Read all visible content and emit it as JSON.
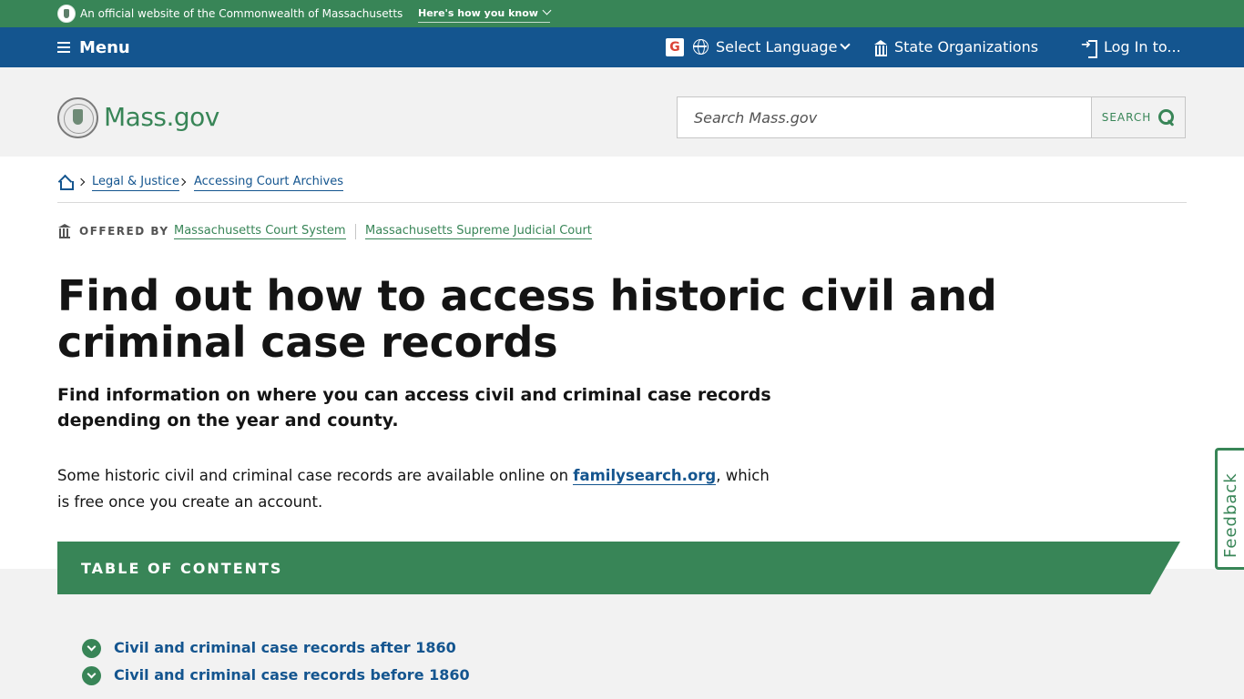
{
  "official_bar": {
    "text": "An official website of the Commonwealth of Massachusetts",
    "how_link": "Here's how you know"
  },
  "utility_nav": {
    "menu_label": "Menu",
    "google_letter": "G",
    "language_label": "Select Language",
    "orgs_label": "State Organizations",
    "login_label": "Log In to..."
  },
  "header": {
    "logo_text": "Mass.gov",
    "search_placeholder": "Search Mass.gov",
    "search_button": "SEARCH"
  },
  "breadcrumbs": [
    "Legal & Justice",
    "Accessing Court Archives"
  ],
  "offered_by": {
    "label": "OFFERED BY",
    "orgs": [
      "Massachusetts Court System",
      "Massachusetts Supreme Judicial Court"
    ]
  },
  "page": {
    "title": "Find out how to access historic civil and criminal case records",
    "lede": "Find information on where you can access civil and criminal case records depending on the year and county.",
    "intro_before": "Some historic civil and criminal case records are available online on ",
    "intro_link": "familysearch.org",
    "intro_after": ", which is free once you create an account."
  },
  "toc": {
    "title": "TABLE OF CONTENTS",
    "items": [
      "Civil and criminal case records after 1860",
      "Civil and criminal case records before 1860"
    ]
  },
  "feedback": {
    "label": "Feedback"
  },
  "colors": {
    "green": "#388557",
    "blue": "#14558f",
    "gray_bg": "#f2f2f2"
  }
}
